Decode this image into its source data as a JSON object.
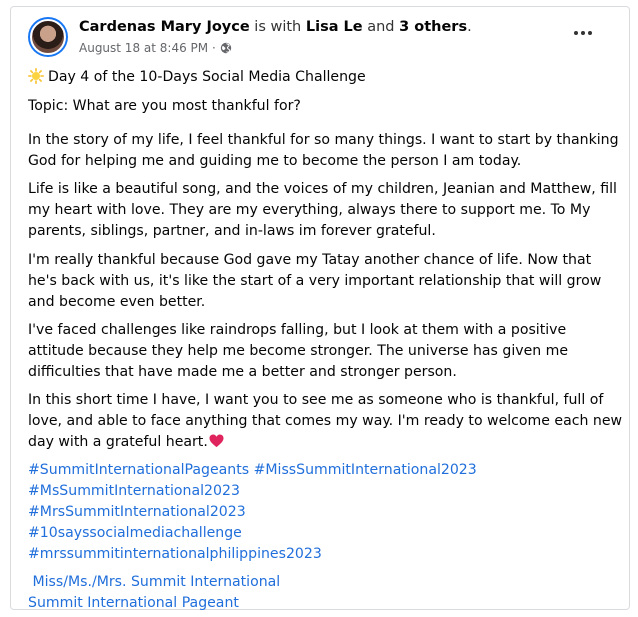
{
  "post": {
    "author": "Cardenas Mary Joyce",
    "with_text": " is with ",
    "tagged_person": "Lisa Le",
    "and_text": " and ",
    "others": "3 others",
    "period": ".",
    "timestamp": "August 18 at 8:46 PM",
    "separator": " · ",
    "privacy_icon": "globe-icon",
    "more_icon": "more-options-icon"
  },
  "content": {
    "title": "Day 4 of the 10-Days Social Media Challenge",
    "title_icon": "sun-emoji",
    "topic": "Topic: What are you most thankful for?",
    "paragraphs": [
      "In the story of my life, I feel thankful for so many things. I want to start by thanking God for helping me and guiding me to become the person I am today.",
      "Life is like a beautiful song, and the voices of my children, Jeanian and Matthew, fill my heart with love. They are my everything, always there to support me. To My parents, siblings, partner, and in-laws im forever grateful.",
      "I'm really thankful because God gave my Tatay another chance of life. Now that he's back with us, it's like the start of a very important relationship that will grow and become even better.",
      "I've faced challenges like raindrops falling, but I look at them with a positive attitude because they help me become stronger. The universe has given me difficulties that have made me a better and stronger person.",
      "In this short time I have, I want you to see me as someone who is thankful, full of love, and able to face anything that comes my way. I'm ready to welcome each new day with a grateful heart."
    ],
    "closing_icon": "red-heart-emoji",
    "hashtags": [
      "#SummitInternationalPageants #MissSummitInternational2023",
      "#MsSummitInternational2023",
      "#MrsSummitInternational2023",
      "#10sayssocialmediachallenge",
      "#mrssummitinternationalphilippines2023"
    ],
    "page_links": [
      " Miss/Ms./Mrs. Summit International",
      "Summit International Pageant"
    ]
  },
  "colors": {
    "link": "#216fdb",
    "meta": "#65676b",
    "avatar_ring": "#1877f2",
    "heart": "#e0245e",
    "sun": "#f7c22b"
  }
}
